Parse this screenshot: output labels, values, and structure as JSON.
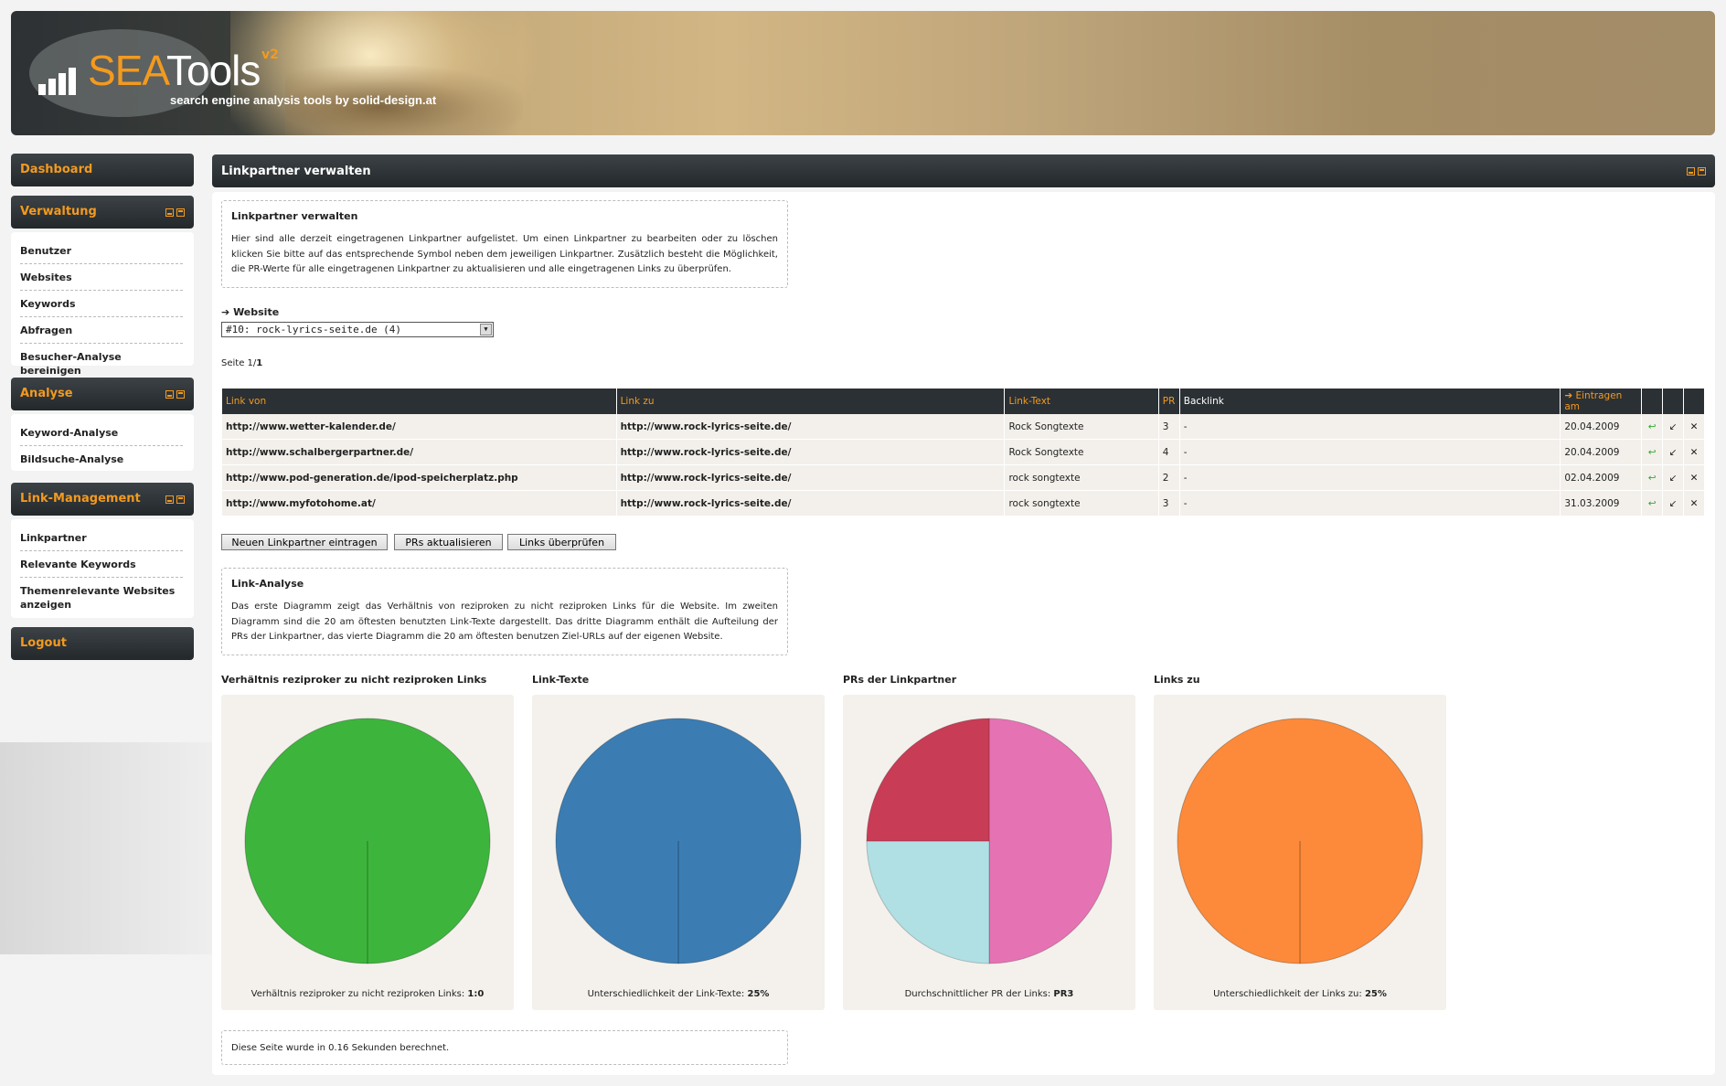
{
  "header": {
    "logo_sea": "SEA",
    "logo_tools": "Tools",
    "logo_version": "v2",
    "tagline": "search engine analysis tools by solid-design.at"
  },
  "sidebar": {
    "dashboard": "Dashboard",
    "sections": [
      {
        "title": "Verwaltung",
        "items": [
          "Benutzer",
          "Websites",
          "Keywords",
          "Abfragen",
          "Besucher-Analyse bereinigen"
        ]
      },
      {
        "title": "Analyse",
        "items": [
          "Keyword-Analyse",
          "Bildsuche-Analyse"
        ]
      },
      {
        "title": "Link-Management",
        "items": [
          "Linkpartner",
          "Relevante Keywords",
          "Themenrelevante Websites anzeigen"
        ]
      }
    ],
    "logout": "Logout"
  },
  "main": {
    "title": "Linkpartner verwalten",
    "intro": {
      "title": "Linkpartner verwalten",
      "text": "Hier sind alle derzeit eingetragenen Linkpartner aufgelistet. Um einen Linkpartner zu bearbeiten oder zu löschen klicken Sie bitte auf das entsprechende Symbol neben dem jeweiligen Linkpartner. Zusätzlich besteht die Möglichkeit, die PR-Werte für alle eingetragenen Linkpartner zu aktualisieren und alle eingetragenen Links zu überprüfen."
    },
    "website_label": "Website",
    "website_selected": "#10: rock-lyrics-seite.de (4)",
    "page_label": "Seite 1/",
    "page_total": "1",
    "table": {
      "headers": [
        "Link von",
        "Link zu",
        "Link-Text",
        "PR",
        "Backlink",
        "Eintragen am"
      ],
      "rows": [
        {
          "von": "http://www.wetter-kalender.de/",
          "zu": "http://www.rock-lyrics-seite.de/",
          "text": "Rock Songtexte",
          "pr": "3",
          "backlink": "-",
          "date": "20.04.2009"
        },
        {
          "von": "http://www.schalbergerpartner.de/",
          "zu": "http://www.rock-lyrics-seite.de/",
          "text": "Rock Songtexte",
          "pr": "4",
          "backlink": "-",
          "date": "20.04.2009"
        },
        {
          "von": "http://www.pod-generation.de/ipod-speicherplatz.php",
          "zu": "http://www.rock-lyrics-seite.de/",
          "text": "rock songtexte",
          "pr": "2",
          "backlink": "-",
          "date": "02.04.2009"
        },
        {
          "von": "http://www.myfotohome.at/",
          "zu": "http://www.rock-lyrics-seite.de/",
          "text": "rock songtexte",
          "pr": "3",
          "backlink": "-",
          "date": "31.03.2009"
        }
      ]
    },
    "buttons": {
      "new": "Neuen Linkpartner eintragen",
      "update_pr": "PRs aktualisieren",
      "check": "Links überprüfen"
    },
    "analysis": {
      "title": "Link-Analyse",
      "text": "Das erste Diagramm zeigt das Verhältnis von reziproken zu nicht reziproken Links für die Website. Im zweiten Diagramm sind die 20 am öftesten benutzten Link-Texte dargestellt. Das dritte Diagramm enthält die Aufteilung der PRs der Linkpartner, das vierte Diagramm die 20 am öftesten benutzen Ziel-URLs auf der eigenen Website."
    },
    "footer": "Diese Seite wurde in 0.16 Sekunden berechnet."
  },
  "colors": {
    "accent": "#f39a1f",
    "dark": "#2b3034",
    "green": "#3db53d",
    "blue": "#3b7db3",
    "orange": "#fd8a3a",
    "crimson": "#c93c56",
    "pink": "#e573b3",
    "lightblue": "#b0dfe4"
  },
  "chart_data": [
    {
      "type": "pie",
      "title": "Verhältnis reziproker zu nicht reziproken Links",
      "caption_label": "Verhältnis reziproker zu nicht reziproken Links:",
      "caption_value": "1:0",
      "slices": [
        {
          "value": 1,
          "color": "#3db53d"
        }
      ]
    },
    {
      "type": "pie",
      "title": "Link-Texte",
      "caption_label": "Unterschiedlichkeit der Link-Texte:",
      "caption_value": "25%",
      "slices": [
        {
          "value": 1,
          "color": "#3b7db3"
        }
      ]
    },
    {
      "type": "pie",
      "title": "PRs der Linkpartner",
      "caption_label": "Durchschnittlicher PR der Links:",
      "caption_value": "PR3",
      "slices": [
        {
          "value": 50,
          "color": "#e573b3"
        },
        {
          "value": 25,
          "color": "#b0dfe4"
        },
        {
          "value": 25,
          "color": "#c93c56"
        }
      ]
    },
    {
      "type": "pie",
      "title": "Links zu",
      "caption_label": "Unterschiedlichkeit der Links zu:",
      "caption_value": "25%",
      "slices": [
        {
          "value": 1,
          "color": "#fd8a3a"
        }
      ]
    }
  ]
}
